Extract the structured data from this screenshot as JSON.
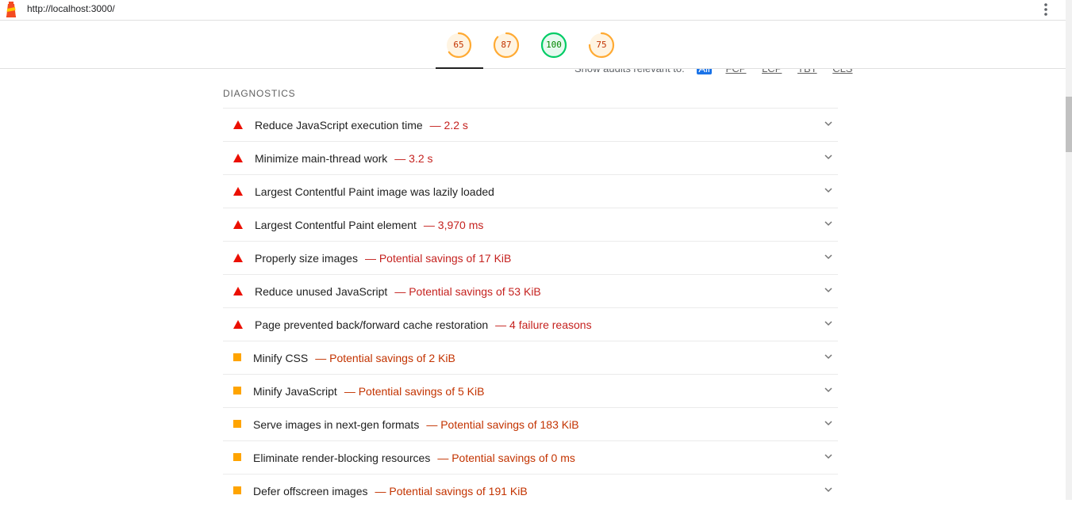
{
  "url": "http://localhost:3000/",
  "scores": [
    {
      "value": "65",
      "fraction": 0.65,
      "color": "#fa3"
    },
    {
      "value": "87",
      "fraction": 0.87,
      "color": "#fa3"
    },
    {
      "value": "100",
      "fraction": 1.0,
      "color": "#0c6"
    },
    {
      "value": "75",
      "fraction": 0.75,
      "color": "#fa3"
    }
  ],
  "filter": {
    "label": "Show audits relevant to:",
    "options": [
      "All",
      "FCP",
      "LCP",
      "TBT",
      "CLS"
    ]
  },
  "section_title": "DIAGNOSTICS",
  "audits": [
    {
      "title": "Reduce JavaScript execution time",
      "value": "— 2.2 s",
      "status": "fail"
    },
    {
      "title": "Minimize main-thread work",
      "value": "— 3.2 s",
      "status": "fail"
    },
    {
      "title": "Largest Contentful Paint image was lazily loaded",
      "value": "",
      "status": "fail"
    },
    {
      "title": "Largest Contentful Paint element",
      "value": "— 3,970 ms",
      "status": "fail"
    },
    {
      "title": "Properly size images",
      "value": "— Potential savings of 17 KiB",
      "status": "fail"
    },
    {
      "title": "Reduce unused JavaScript",
      "value": "— Potential savings of 53 KiB",
      "status": "fail"
    },
    {
      "title": "Page prevented back/forward cache restoration",
      "value": "— 4 failure reasons",
      "status": "fail"
    },
    {
      "title": "Minify CSS",
      "value": "— Potential savings of 2 KiB",
      "status": "average"
    },
    {
      "title": "Minify JavaScript",
      "value": "— Potential savings of 5 KiB",
      "status": "average"
    },
    {
      "title": "Serve images in next-gen formats",
      "value": "— Potential savings of 183 KiB",
      "status": "average"
    },
    {
      "title": "Eliminate render-blocking resources",
      "value": "— Potential savings of 0 ms",
      "status": "average"
    },
    {
      "title": "Defer offscreen images",
      "value": "— Potential savings of 191 KiB",
      "status": "average"
    }
  ],
  "icons": {
    "fail": "fail-triangle-icon",
    "average": "average-square-icon",
    "expand": "chevron-down-icon"
  }
}
